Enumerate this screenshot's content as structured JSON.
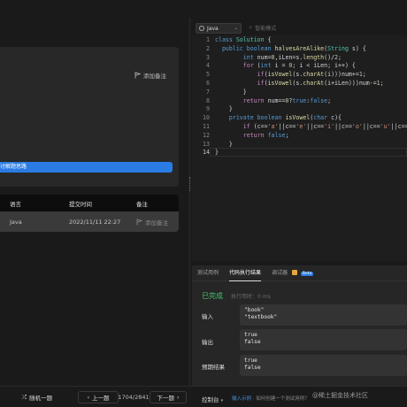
{
  "description": {
    "add_note": "添加备注",
    "banner_text": "讨解题思路"
  },
  "submissions": {
    "headers": [
      "语言",
      "提交时间",
      "备注"
    ],
    "rows": [
      {
        "language": "Java",
        "time": "2022/11/11 22:27",
        "note": "添加备注"
      }
    ]
  },
  "editor": {
    "language": "Java",
    "smart_mode": "智能模式",
    "lines": [
      "class Solution {",
      "    public boolean halvesAreAlike(String s) {",
      "        int num=0,iLen=s.length()/2;",
      "        for (int i = 0; i < iLen; i++) {",
      "            if(isVowel(s.charAt(i)))num+=1;",
      "            if(isVowel(s.charAt(i+iLen)))num-=1;",
      "        }",
      "        return num==0?true:false;",
      "    }",
      "    private boolean isVowel(char c){",
      "        if (c=='a'||c=='e'||c=='i'||c=='o'||c=='u'||c=='A",
      "        return false;",
      "    }",
      "}"
    ],
    "line_numbers": [
      "1",
      "2",
      "3",
      "4",
      "5",
      "6",
      "7",
      "8",
      "9",
      "10",
      "11",
      "12",
      "13",
      "14"
    ]
  },
  "result_panel": {
    "tabs": [
      "测试用例",
      "代码执行结果",
      "调试器"
    ],
    "beta": "Beta",
    "status": "已完成",
    "runtime": "执行用时：0 ms",
    "input_label": "输入",
    "input_values": [
      "\"book\"",
      "\"textbook\""
    ],
    "output_label": "输出",
    "output_values": [
      "true",
      "false"
    ],
    "expected_label": "预期结果",
    "expected_values": [
      "true",
      "false"
    ]
  },
  "bottom_bar": {
    "random": "随机一题",
    "prev": "上一题",
    "counter": "1704/2841",
    "next": "下一题",
    "console": "控制台",
    "hint_link": "输入示例",
    "hint_text": "·  如何创建一个测试用例？"
  },
  "watermark": "@稀土掘金技术社区",
  "colors": {
    "accent_blue": "#2a7be4",
    "success_green": "#46c26e"
  }
}
